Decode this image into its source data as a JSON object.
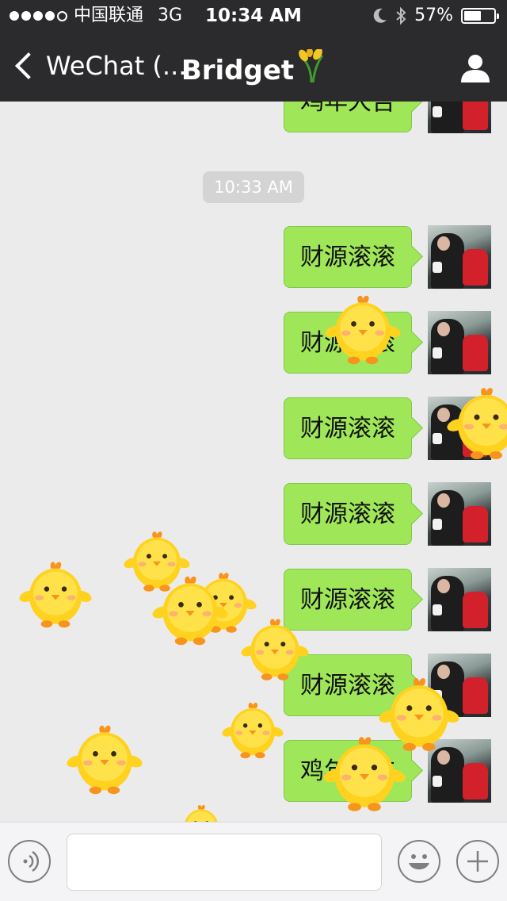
{
  "status_bar": {
    "carrier": "中国联通",
    "network": "3G",
    "time": "10:34 AM",
    "battery_percent": "57%",
    "battery_level": 0.57
  },
  "nav": {
    "back_label": "WeChat (...",
    "title": "Bridget"
  },
  "chat": {
    "timestamp": "10:33 AM",
    "messages": [
      {
        "text": "鸡年大吉"
      },
      {
        "text": "财源滚滚"
      },
      {
        "text": "财源滚滚"
      },
      {
        "text": "财源滚滚"
      },
      {
        "text": "财源滚滚"
      },
      {
        "text": "财源滚滚"
      },
      {
        "text": "财源滚滚"
      },
      {
        "text": "鸡年大吉"
      }
    ]
  },
  "icons": {
    "back": "chevron-left-icon",
    "profile": "person-icon",
    "voice": "voice-icon",
    "emoji": "emoji-icon",
    "plus": "plus-icon",
    "overlay": "chick-icon"
  },
  "colors": {
    "bubble": "#9fe658",
    "nav_bg": "#2b2b2d",
    "chat_bg": "#ebebeb"
  }
}
